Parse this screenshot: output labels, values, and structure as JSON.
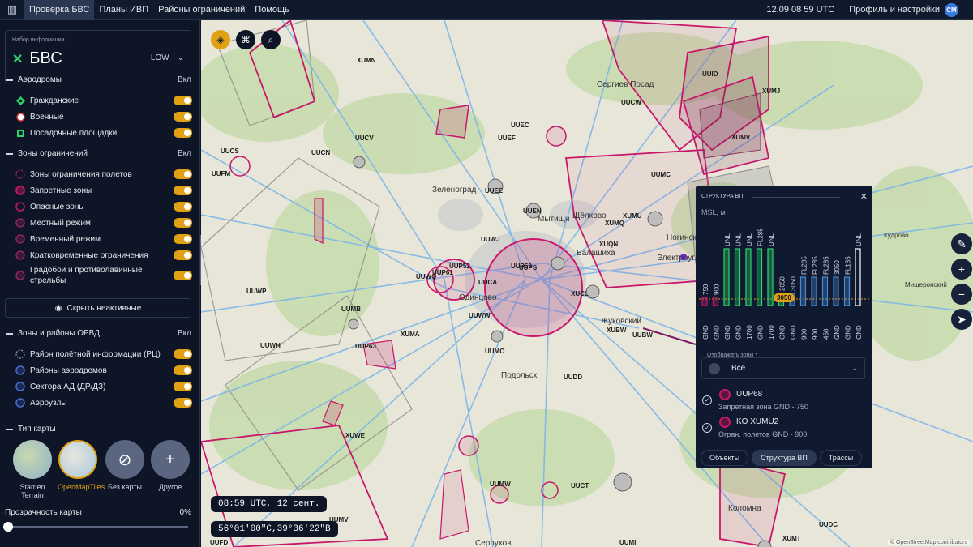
{
  "topbar": {
    "tabs": [
      "Проверка БВС",
      "Планы ИВП",
      "Районы ограничений",
      "Помощь"
    ],
    "time": "12.09 08 59 UTC",
    "profile": "Профиль и настройки",
    "avatar": "CM"
  },
  "dataset": {
    "label": "Набор информации",
    "name": "БВС",
    "mode": "LOW"
  },
  "sections": {
    "aerodromes": {
      "title": "Аэродромы",
      "state": "Вкл",
      "items": [
        "Гражданские",
        "Военные",
        "Посадочные площадки"
      ]
    },
    "restrictions": {
      "title": "Зоны ограничений",
      "state": "Вкл",
      "items": [
        "Зоны ограничения полетов",
        "Запретные зоны",
        "Опасные зоны",
        "Местный режим",
        "Временный режим",
        "Кратковременные ограничения",
        "Градобои и противолавинные стрельбы"
      ]
    },
    "hide_inactive": "Скрыть неактивные",
    "orvd": {
      "title": "Зоны и районы ОРВД",
      "state": "Вкл",
      "items": [
        "Район полётной информации (РЦ)",
        "Районы аэродромов",
        "Сектора АД (ДР/ДЗ)",
        "Аэроузлы"
      ]
    },
    "maptype": {
      "title": "Тип карты",
      "items": [
        "Stamen Terrain",
        "OpenMapTiles",
        "Без карты",
        "Другое"
      ]
    },
    "opacity": {
      "label": "Прозрачность карты",
      "value": "0%"
    }
  },
  "map": {
    "time_pill": "08:59 UTC, 12 сент.",
    "coord_pill": "56°01′00″С,39°36′22″В",
    "labels": [
      "XUMN",
      "UUCN",
      "UUCV",
      "UUEC",
      "UUEF",
      "UUEE",
      "UUEN",
      "UUWJ",
      "UUWQ",
      "UUCA",
      "UUWW",
      "UUMO",
      "UUDD",
      "UUWP",
      "UUMB",
      "XUMA",
      "UUWH",
      "UUMW",
      "XUWE",
      "UUMV",
      "UUCT",
      "UUMI",
      "UUFD",
      "UUCW",
      "UUID",
      "XUMJ",
      "XUMV",
      "UUMC",
      "XUMQ",
      "XUMU",
      "XUQN",
      "XUCL",
      "XUBW",
      "UUBW",
      "UUDC",
      "XUMT",
      "UUCS",
      "UUFM",
      "UUPS",
      "UUP52",
      "UUP53",
      "UUP61",
      "UUP63"
    ],
    "cities": [
      "Зеленоград",
      "Мытищи",
      "Щёлково",
      "Ногинск",
      "Балашиха",
      "Одинцово",
      "Подольск",
      "Жуковский",
      "Сергиев Посад",
      "Коломна",
      "Серпухов",
      "Мищеронский",
      "Электроугли",
      "Кудрово"
    ],
    "attribution": "© OpenStreetMap contributors"
  },
  "panel": {
    "title": "СТРУКТУРА ВП",
    "units": "MSL, м",
    "marker": "3050",
    "show_zones_label": "Отображать зоны *",
    "show_zones_value": "Все",
    "zones": [
      {
        "name": "UUP68",
        "desc": "Запретная зона GND - 750"
      },
      {
        "name": "KO XUMU2",
        "desc": "Огран. полетов GND - 900"
      }
    ],
    "tabs": [
      "Объекты",
      "Структура ВП",
      "Трассы"
    ],
    "bars_top": [
      "750",
      "900",
      "UNL",
      "UNL",
      "UNL",
      "FL285",
      "UNL",
      "2050",
      "3050",
      "FL285",
      "FL285",
      "FL285",
      "3050",
      "FL135",
      "UNL"
    ],
    "bars_bottom": [
      "GND",
      "GND",
      "GND",
      "GND",
      "1700",
      "GND",
      "1700",
      "GND",
      "GND",
      "900",
      "900",
      "450",
      "GND",
      "GND",
      "GND"
    ]
  }
}
